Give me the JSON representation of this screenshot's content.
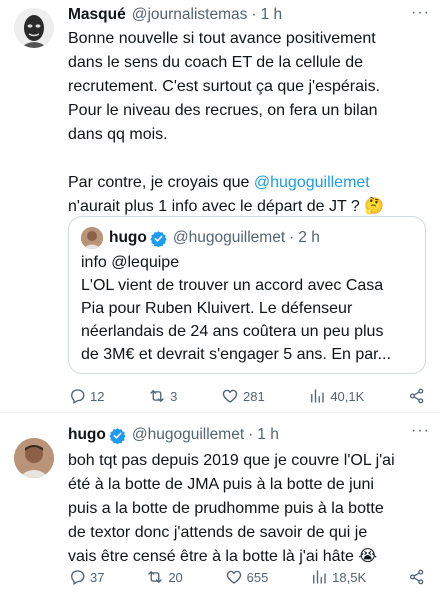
{
  "tweet1": {
    "name": "Masqué",
    "handle": "@journalistemas",
    "dot": "·",
    "time": "1 h",
    "more": "···",
    "lines": [
      "Bonne nouvelle si tout avance positivement",
      "dans le sens du coach ET de la cellule de",
      "recrutement. C'est surtout ça que j'espérais.",
      "Pour le niveau des recrues, on fera un bilan",
      "dans qq mois."
    ],
    "line2_prefix": "Par contre, je croyais que ",
    "line2_mention": "@hugoguillemet",
    "line2_suffix": "n'aurait plus 1 info avec le départ de JT ? 🤔",
    "quote": {
      "name": "hugo",
      "handle": "@hugoguillemet",
      "dot": "·",
      "time": "2 h",
      "lines": [
        "info @lequipe",
        "L'OL vient de trouver un accord avec Casa",
        "Pia pour Ruben Kluivert. Le défenseur",
        "néerlandais de 24 ans coûtera un peu plus",
        "de 3M€ et devrait s'engager 5 ans. En par..."
      ]
    },
    "stats": {
      "replies": "12",
      "retweets": "3",
      "likes": "281",
      "views": "40,1K"
    }
  },
  "tweet2": {
    "name": "hugo",
    "handle": "@hugoguillemet",
    "dot": "·",
    "time": "1 h",
    "more": "···",
    "lines": [
      "boh tqt pas depuis 2019 que je couvre l'OL j'ai",
      "été à la botte de JMA puis à la botte de juni",
      "puis a la botte de prudhomme puis à la botte",
      "de textor donc j'attends de savoir de qui je",
      "vais être censé être à la botte là j'ai hâte 😭"
    ],
    "stats": {
      "replies": "37",
      "retweets": "20",
      "likes": "655",
      "views": "18,5K"
    }
  },
  "colors": {
    "accent": "#1d9bf0",
    "muted": "#536471",
    "border": "#cfd9de"
  },
  "icons": [
    "reply-icon",
    "retweet-icon",
    "like-icon",
    "views-icon",
    "share-icon",
    "verified-badge-icon",
    "more-icon"
  ]
}
